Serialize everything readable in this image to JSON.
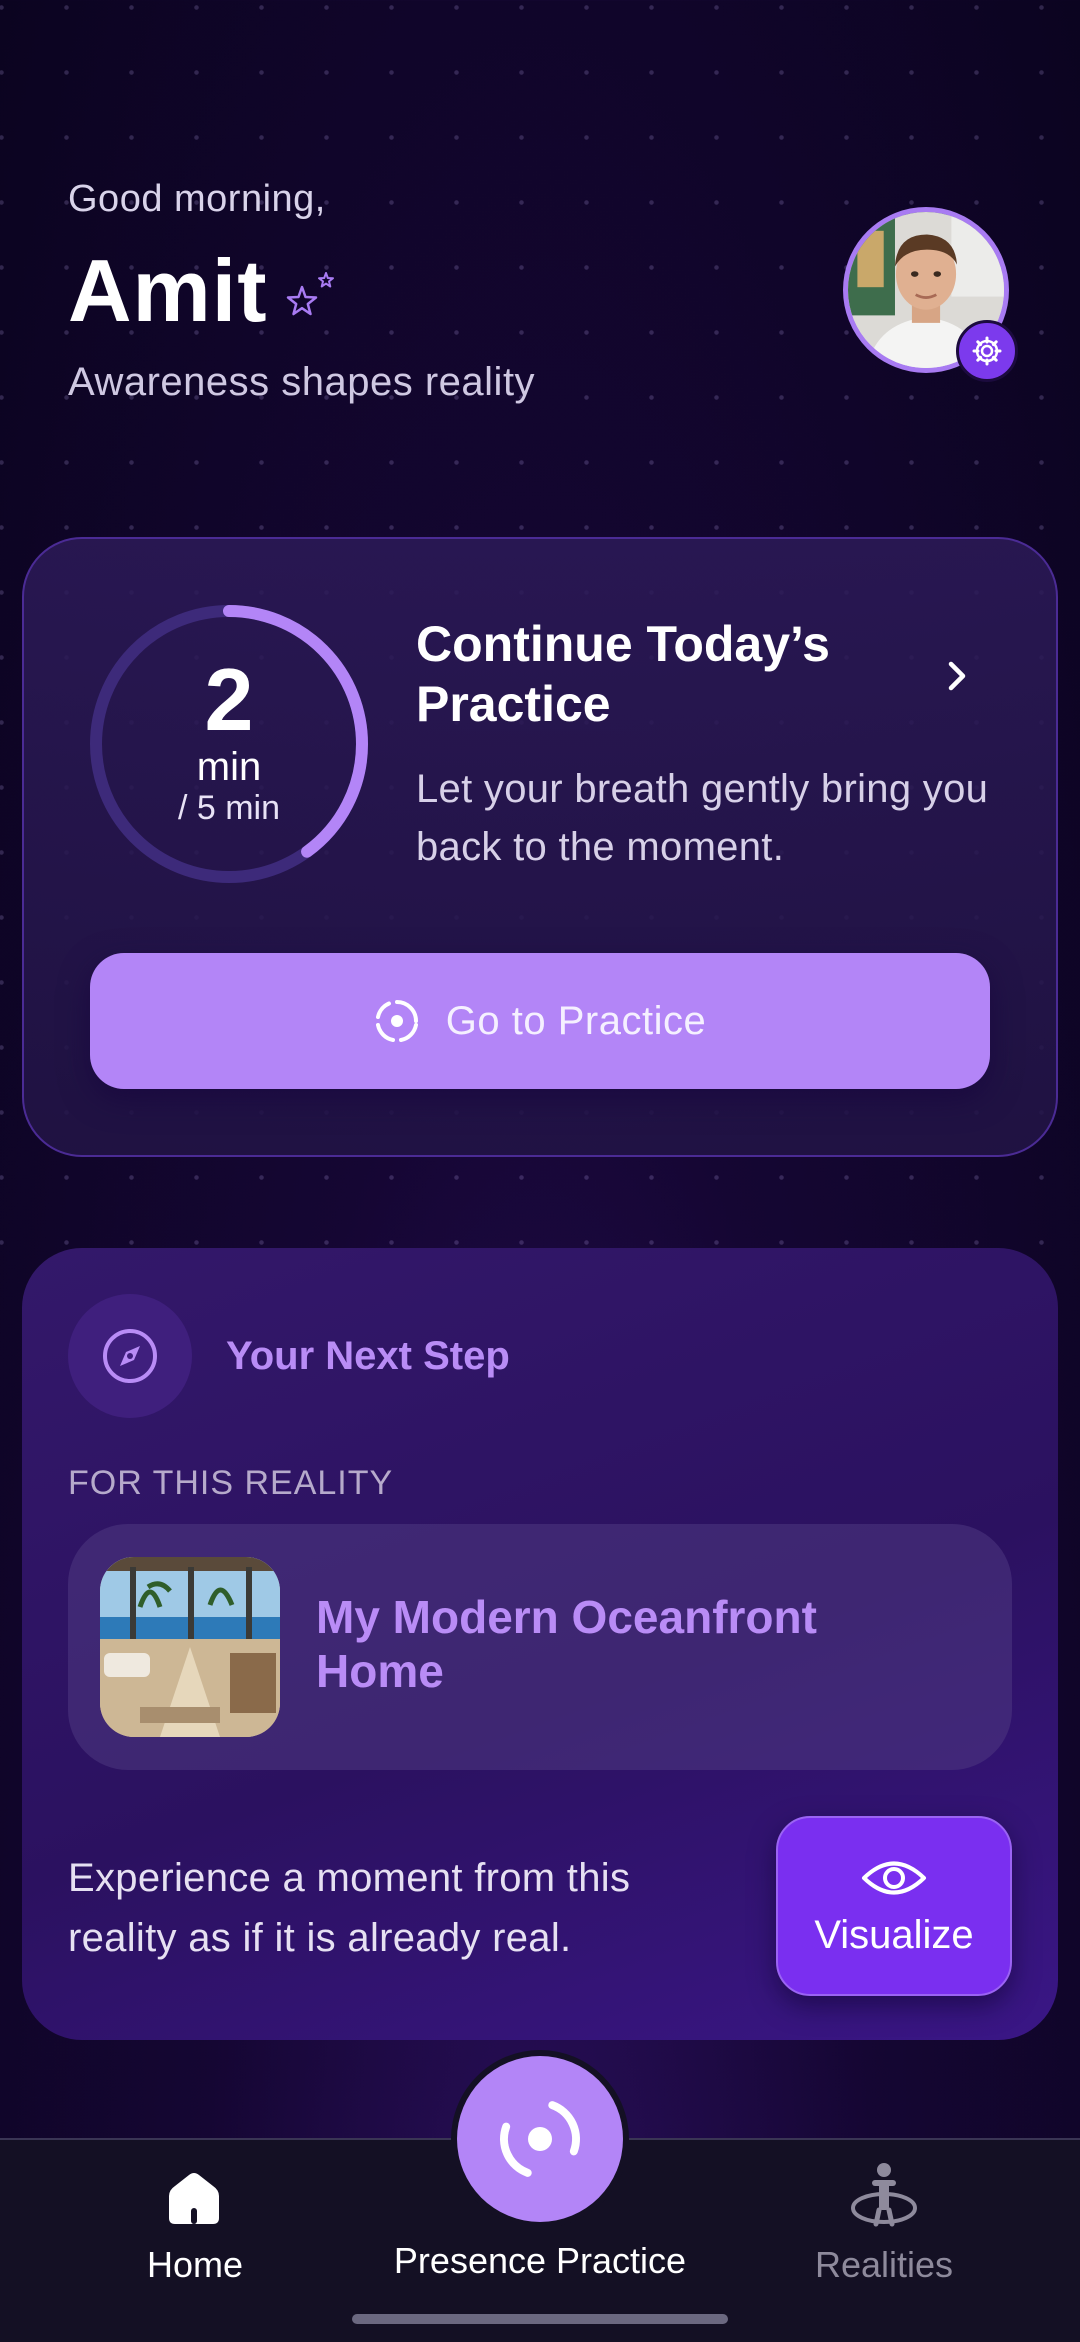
{
  "header": {
    "greeting": "Good morning,",
    "name": "Amit",
    "tagline": "Awareness shapes reality"
  },
  "practice": {
    "minutes_done": "2",
    "unit": "min",
    "total": "/ 5 min",
    "progress_fraction": 0.4,
    "title": "Continue Today’s Practice",
    "description": "Let your breath gently bring you back to the moment.",
    "button_label": "Go to Practice"
  },
  "next_step": {
    "title": "Your Next Step",
    "section_label": "FOR THIS REALITY",
    "reality_name": "My Modern Oceanfront Home",
    "description": "Experience a moment from this reality as if it is already real.",
    "visualize_label": "Visualize"
  },
  "nav": {
    "home": "Home",
    "presence": "Presence Practice",
    "realities": "Realities"
  },
  "colors": {
    "accent": "#b385f7",
    "accent_deep": "#7a2ff0",
    "title_purple": "#b98cf6"
  }
}
